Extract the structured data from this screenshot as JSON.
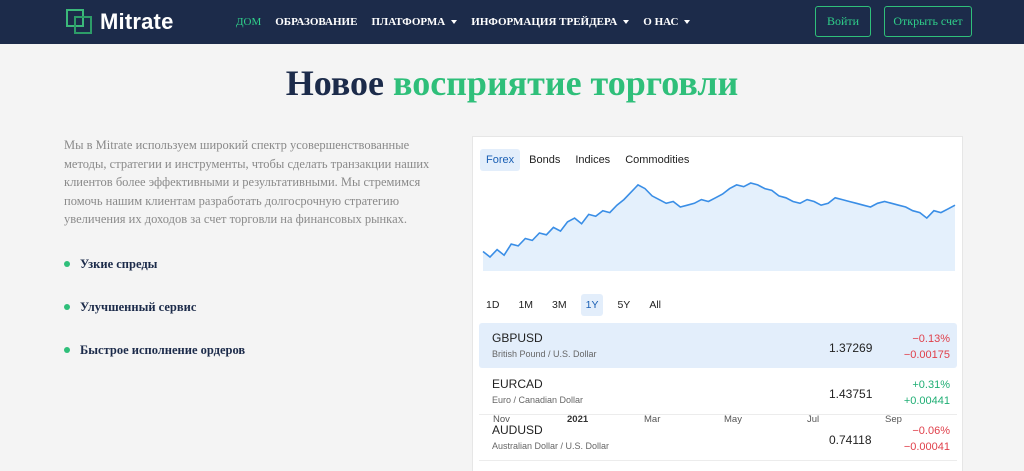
{
  "brand": {
    "name": "Mitrate"
  },
  "nav": {
    "items": [
      {
        "label": "ДОМ",
        "active": true,
        "dropdown": false
      },
      {
        "label": "ОБРАЗОВАНИЕ",
        "active": false,
        "dropdown": false
      },
      {
        "label": "ПЛАТФОРМА",
        "active": false,
        "dropdown": true
      },
      {
        "label": "ИНФОРМАЦИЯ ТРЕЙДЕРА",
        "active": false,
        "dropdown": true
      },
      {
        "label": "О НАС",
        "active": false,
        "dropdown": true
      }
    ],
    "login_label": "Войти",
    "open_account_label": "Открыть счет"
  },
  "hero": {
    "title_dark": "Новое",
    "title_green": "восприятие торговли"
  },
  "intro": {
    "text": "Мы в Mitrate используем широкий спектр усовершенствованные методы, стратегии и инструменты, чтобы сделать транзакции наших клиентов более эффективными и результативными. Мы стремимся помочь нашим клиентам разработать долгосрочную стратегию увеличения их доходов за счет торговли на финансовых рынках."
  },
  "features": [
    "Узкие спреды",
    "Улучшенный сервис",
    "Быстрое исполнение ордеров"
  ],
  "widget": {
    "tabs": [
      "Forex",
      "Bonds",
      "Indices",
      "Commodities"
    ],
    "active_tab": 0,
    "ranges": [
      "1D",
      "1M",
      "3M",
      "1Y",
      "5Y",
      "All"
    ],
    "active_range": 3,
    "quotes": [
      {
        "symbol": "GBPUSD",
        "name": "British Pound / U.S. Dollar",
        "price": "1.37269",
        "change_pct": "−0.13%",
        "change_abs": "−0.00175",
        "direction": "down",
        "selected": true
      },
      {
        "symbol": "EURCAD",
        "name": "Euro / Canadian Dollar",
        "price": "1.43751",
        "change_pct": "+0.31%",
        "change_abs": "+0.00441",
        "direction": "up",
        "selected": false
      },
      {
        "symbol": "AUDUSD",
        "name": "Australian Dollar / U.S. Dollar",
        "price": "0.74118",
        "change_pct": "−0.06%",
        "change_abs": "−0.00041",
        "direction": "down",
        "selected": false
      }
    ]
  },
  "chart_data": {
    "type": "area",
    "title": "",
    "xlabel": "",
    "ylabel": "",
    "x_tick_labels": [
      "Nov",
      "2021",
      "Mar",
      "May",
      "Jul",
      "Sep"
    ],
    "series": [
      {
        "values": [
          1.22,
          1.205,
          1.225,
          1.21,
          1.24,
          1.235,
          1.255,
          1.25,
          1.27,
          1.265,
          1.285,
          1.275,
          1.3,
          1.31,
          1.295,
          1.32,
          1.315,
          1.33,
          1.325,
          1.345,
          1.36,
          1.38,
          1.4,
          1.39,
          1.37,
          1.36,
          1.35,
          1.355,
          1.34,
          1.345,
          1.35,
          1.36,
          1.355,
          1.365,
          1.375,
          1.39,
          1.4,
          1.395,
          1.405,
          1.4,
          1.39,
          1.385,
          1.37,
          1.365,
          1.355,
          1.35,
          1.36,
          1.355,
          1.345,
          1.35,
          1.365,
          1.36,
          1.355,
          1.35,
          1.345,
          1.34,
          1.35,
          1.355,
          1.35,
          1.345,
          1.34,
          1.33,
          1.325,
          1.31,
          1.33,
          1.325,
          1.335,
          1.345
        ]
      }
    ],
    "colors": {
      "line": "#3a8ee6",
      "fill": "#e4f0fc"
    },
    "grid": false
  }
}
